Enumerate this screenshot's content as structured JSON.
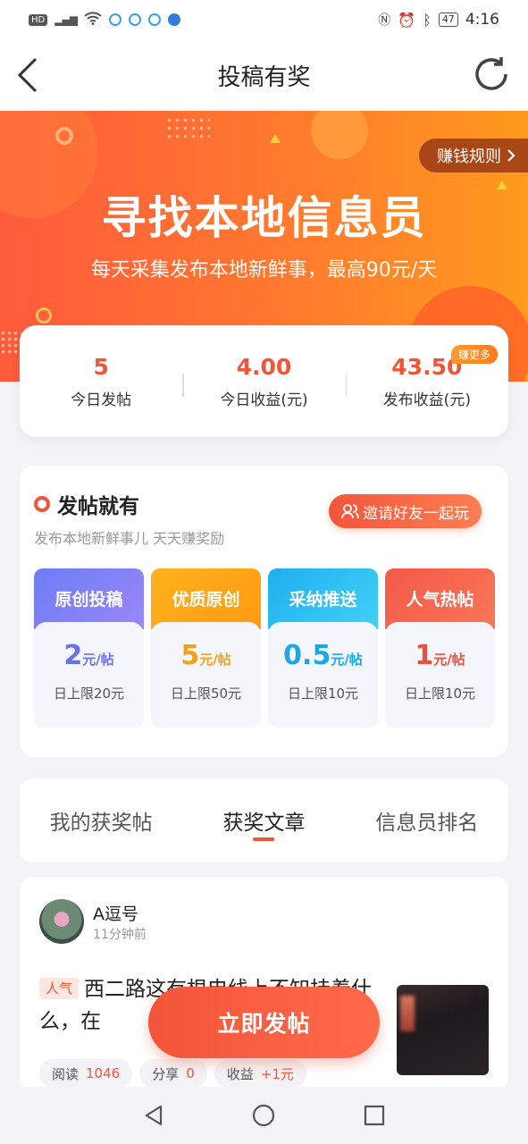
{
  "status_bar": {
    "hd": "HD",
    "signal": "4G",
    "battery": "47",
    "time": "4:16"
  },
  "nav": {
    "title": "投稿有奖"
  },
  "banner": {
    "title": "寻找本地信息员",
    "subtitle": "每天采集发布本地新鲜事，最高90元/天",
    "rules_button": "赚钱规则",
    "colors": {
      "start": "#ff5a3c",
      "end": "#ff9a1e"
    }
  },
  "stats": [
    {
      "value": "5",
      "label": "今日发帖"
    },
    {
      "value": "4.00",
      "label": "今日收益(元)"
    },
    {
      "value": "43.50",
      "label": "发布收益(元)",
      "badge": "赚更多"
    }
  ],
  "post_section": {
    "title": "发帖就有",
    "subtitle": "发布本地新鲜事儿 天天赚奖励",
    "invite_button": "邀请好友一起玩",
    "tiers": [
      {
        "name": "原创投稿",
        "amount": "2",
        "unit": "元/帖",
        "limit": "日上限20元",
        "color": "#7b7ff5"
      },
      {
        "name": "优质原创",
        "amount": "5",
        "unit": "元/帖",
        "limit": "日上限50元",
        "color": "#ffa31a"
      },
      {
        "name": "采纳推送",
        "amount": "0.5",
        "unit": "元/帖",
        "limit": "日上限10元",
        "color": "#24b8f0"
      },
      {
        "name": "人气热帖",
        "amount": "1",
        "unit": "元/帖",
        "limit": "日上限10元",
        "color": "#f25a4a"
      }
    ]
  },
  "tabs": [
    {
      "label": "我的获奖帖",
      "active": false
    },
    {
      "label": "获奖文章",
      "active": true
    },
    {
      "label": "信息员排名",
      "active": false
    }
  ],
  "article": {
    "author": "A逗号",
    "time": "11分钟前",
    "tag": "人气",
    "title": "西二路这有根电线上不知挂着什么，在",
    "stats": [
      {
        "label": "阅读",
        "value": "1046"
      },
      {
        "label": "分享",
        "value": "0"
      },
      {
        "label": "收益",
        "value": "+1元"
      }
    ]
  },
  "fab": {
    "label": "立即发帖"
  }
}
